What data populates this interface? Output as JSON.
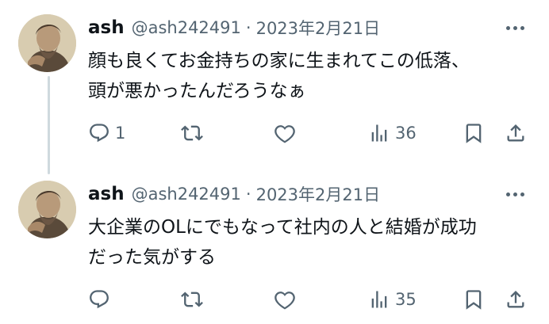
{
  "tweets": [
    {
      "name": "ash",
      "handle": "@ash242491",
      "separator": "·",
      "date": "2023年2月21日",
      "text_lines": [
        "顔も良くてお金持ちの家に生まれてこの低落、",
        "頭が悪かったんだろうなぁ"
      ],
      "reply_count": "1",
      "view_count": "36"
    },
    {
      "name": "ash",
      "handle": "@ash242491",
      "separator": "·",
      "date": "2023年2月21日",
      "text_lines": [
        "大企業のOLにでもなって社内の人と結婚が成功",
        "だった気がする"
      ],
      "reply_count": "",
      "view_count": "35"
    }
  ],
  "icons": {
    "reply": "reply-icon",
    "retweet": "retweet-icon",
    "like": "heart-icon",
    "views": "views-chart-icon",
    "bookmark": "bookmark-icon",
    "share": "share-icon",
    "more": "more-icon"
  },
  "colors": {
    "text": "#0f1419",
    "secondary": "#536471",
    "thread_line": "#cfd9de"
  }
}
